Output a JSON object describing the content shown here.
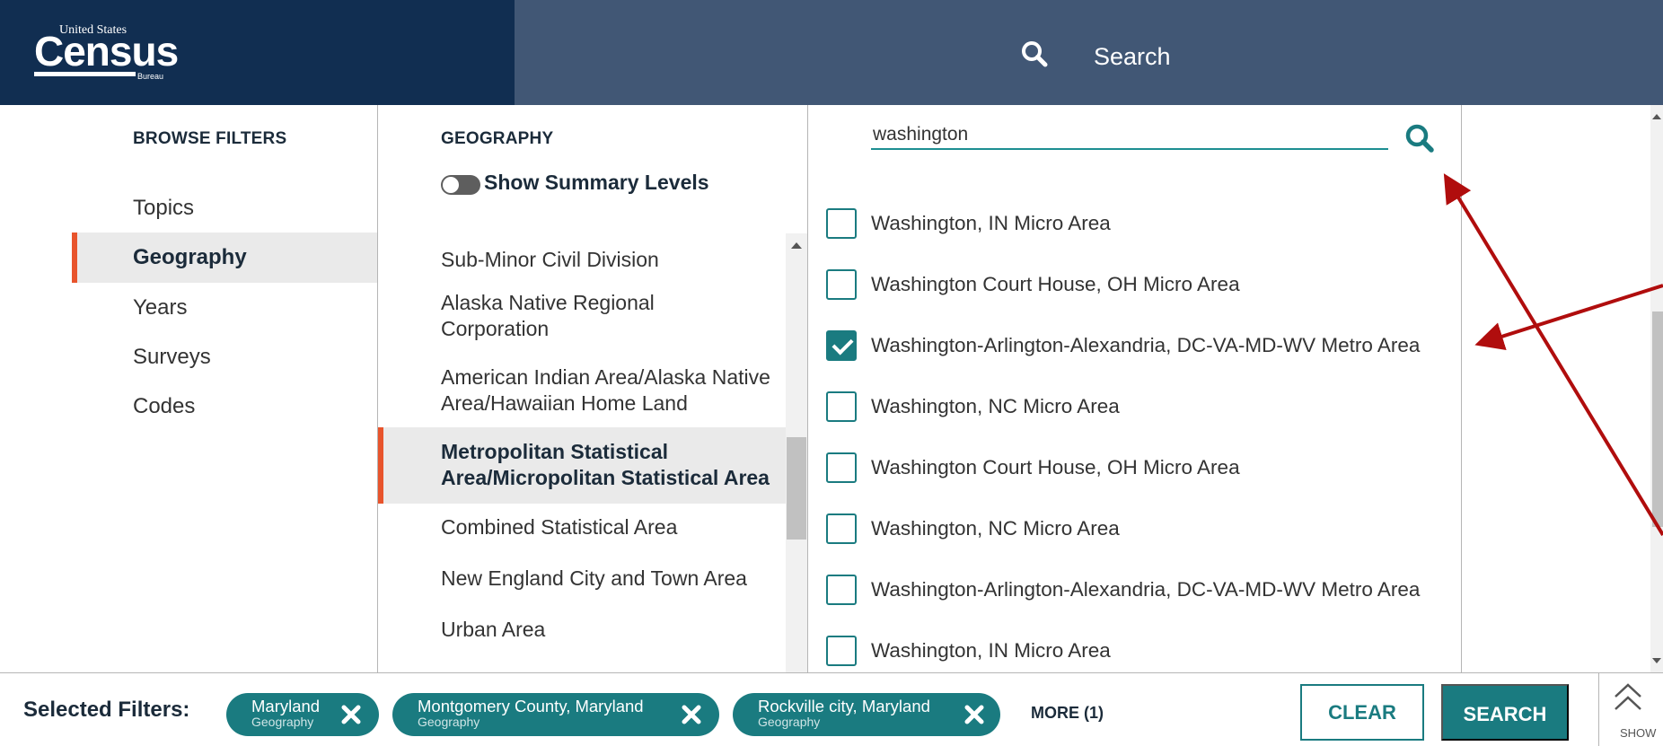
{
  "header": {
    "logo_top": "United States",
    "logo_main": "Census",
    "logo_bottom": "Bureau",
    "search_label": "Search"
  },
  "browse": {
    "heading": "BROWSE FILTERS",
    "items": [
      "Topics",
      "Geography",
      "Years",
      "Surveys",
      "Codes"
    ],
    "active": "Geography"
  },
  "geography": {
    "heading": "GEOGRAPHY",
    "toggle_label": "Show Summary Levels",
    "toggle_on": false,
    "items": [
      "Sub-Minor Civil Division",
      "Alaska Native Regional Corporation",
      "American Indian Area/Alaska Native Area/Hawaiian Home Land",
      "Metropolitan Statistical Area/Micropolitan Statistical Area",
      "Combined Statistical Area",
      "New England City and Town Area",
      "Urban Area"
    ],
    "active": "Metropolitan Statistical Area/Micropolitan Statistical Area"
  },
  "results": {
    "search_value": "washington",
    "items": [
      {
        "label": "Washington, IN Micro Area",
        "checked": false
      },
      {
        "label": "Washington Court House, OH Micro Area",
        "checked": false
      },
      {
        "label": "Washington-Arlington-Alexandria, DC-VA-MD-WV Metro Area",
        "checked": true
      },
      {
        "label": "Washington, NC Micro Area",
        "checked": false
      },
      {
        "label": "Washington Court House, OH Micro Area",
        "checked": false
      },
      {
        "label": "Washington, NC Micro Area",
        "checked": false
      },
      {
        "label": "Washington-Arlington-Alexandria, DC-VA-MD-WV Metro Area",
        "checked": false
      },
      {
        "label": "Washington, IN Micro Area",
        "checked": false
      }
    ]
  },
  "bottom": {
    "selected_label": "Selected Filters:",
    "chips": [
      {
        "name": "Maryland",
        "type": "Geography"
      },
      {
        "name": "Montgomery County, Maryland",
        "type": "Geography"
      },
      {
        "name": "Rockville city, Maryland",
        "type": "Geography"
      }
    ],
    "more_label": "MORE (1)",
    "clear_label": "CLEAR",
    "search_label": "SEARCH",
    "show_label": "SHOW"
  },
  "colors": {
    "header_dark": "#112e51",
    "header_search": "#415775",
    "teal": "#1a7b80",
    "active_accent": "#e8542c",
    "annotation_arrow": "#b00d0d"
  }
}
